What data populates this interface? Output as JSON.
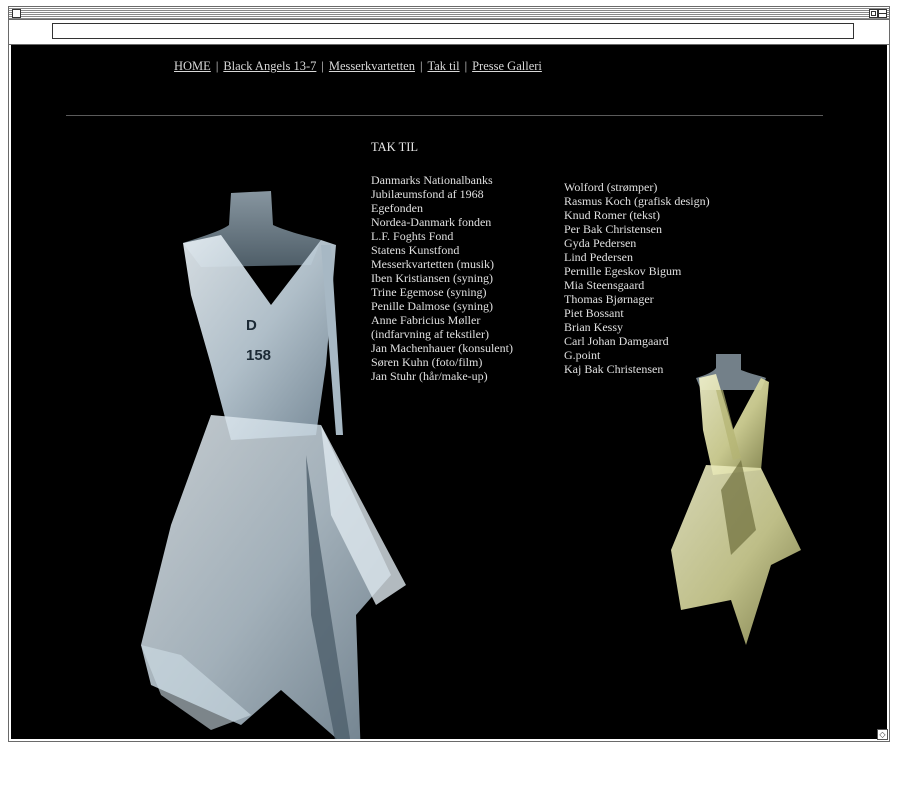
{
  "nav": {
    "items": [
      {
        "label": "HOME"
      },
      {
        "label": "Black Angels 13-7"
      },
      {
        "label": "Messerkvartetten"
      },
      {
        "label": "Tak til"
      },
      {
        "label": "Presse Galleri"
      }
    ]
  },
  "heading": "TAK TIL",
  "thanks_left": [
    "Danmarks Nationalbanks",
    "Jubilæumsfond af 1968",
    "Egefonden",
    "Nordea-Danmark fonden",
    "L.F. Foghts Fond",
    "Statens Kunstfond",
    "Messerkvartetten (musik)",
    "Iben Kristiansen (syning)",
    "Trine Egemose (syning)",
    "Penille Dalmose (syning)",
    "Anne Fabricius Møller",
    "(indfarvning af tekstiler)",
    "Jan Machenhauer (konsulent)",
    "Søren Kuhn (foto/film)",
    "Jan Stuhr (hår/make-up)"
  ],
  "thanks_right": [
    "Wolford (strømper)",
    "Rasmus Koch (grafisk design)",
    "Knud Romer (tekst)",
    "Per Bak Christensen",
    "Gyda Pedersen",
    "Lind Pedersen",
    "Pernille Egeskov Bigum",
    "Mia Steensgaard",
    "Thomas Bjørnager",
    "Piet Bossant",
    "Brian Kessy",
    "Carl Johan Damgaard",
    "G.point",
    "Kaj Bak Christensen"
  ],
  "dress_left": {
    "label_line1": "D",
    "label_line2": "158"
  },
  "colors": {
    "background": "#000000",
    "text": "#e0e0e0",
    "dress_left": "#c9d7e0",
    "dress_right": "#e2e3b0"
  }
}
